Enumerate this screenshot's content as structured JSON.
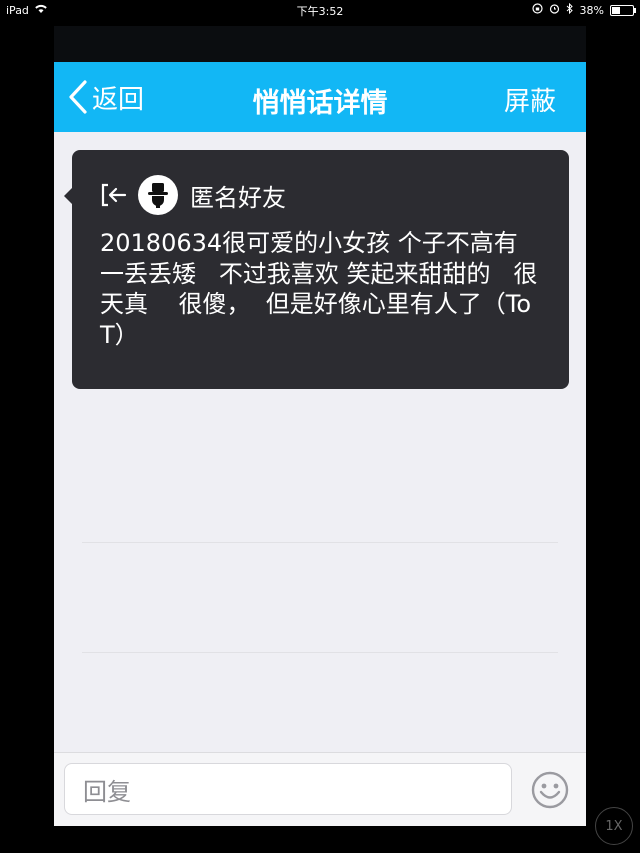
{
  "status_bar": {
    "device": "iPad",
    "time": "下午3:52",
    "battery": "38%",
    "battery_level": 0.38
  },
  "nav": {
    "back_label": "返回",
    "title": "悄悄话详情",
    "right_label": "屏蔽"
  },
  "message": {
    "sender": "匿名好友",
    "text": "20180634很可爱的小女孩 个子不高有一丢丢矮   不过我喜欢 笑起来甜甜的   很天真    很傻，  但是好像心里有人了（ToT）"
  },
  "reply": {
    "placeholder": "回复"
  },
  "zoom": {
    "label": "1X"
  },
  "colors": {
    "nav_bg": "#12b7f5",
    "bubble_bg": "#2c2c31",
    "content_bg": "#efeff4"
  }
}
